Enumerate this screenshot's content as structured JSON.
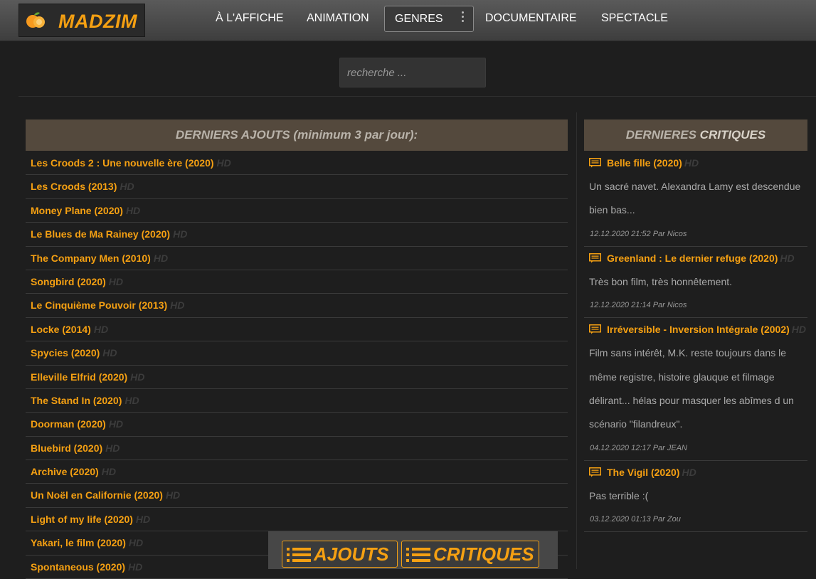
{
  "logo": {
    "text": "MADZIM"
  },
  "nav": {
    "items": [
      "À L'AFFICHE",
      "ANIMATION"
    ],
    "genres": "GENRES",
    "items_after": [
      "DOCUMENTAIRE",
      "SPECTACLE"
    ]
  },
  "search": {
    "placeholder": "recherche ..."
  },
  "latest": {
    "heading": "DERNIERS AJOUTS (minimum 3 par jour):",
    "quality": "HD",
    "films": [
      "Les Croods 2 : Une nouvelle ère (2020)",
      "Les Croods (2013)",
      "Money Plane (2020)",
      "Le Blues de Ma Rainey (2020)",
      "The Company Men (2010)",
      "Songbird (2020)",
      "Le Cinquième Pouvoir (2013)",
      "Locke (2014)",
      "Spycies (2020)",
      "Elleville Elfrid (2020)",
      "The Stand In (2020)",
      "Doorman (2020)",
      "Bluebird (2020)",
      "Archive (2020)",
      "Un Noël en Californie (2020)",
      "Light of my life (2020)",
      "Yakari, le film (2020)",
      "Spontaneous (2020)"
    ]
  },
  "reviews": {
    "heading_a": "DERNIERES ",
    "heading_b": "CRITIQUES",
    "quality": "HD",
    "items": [
      {
        "title": "Belle fille (2020)",
        "text": "Un sacré navet. Alexandra Lamy est descendue bien bas...",
        "meta": "12.12.2020 21:52 Par Nicos"
      },
      {
        "title": "Greenland : Le dernier refuge (2020)",
        "text": "Très bon film, très honnêtement.",
        "meta": "12.12.2020 21:14 Par Nicos"
      },
      {
        "title": "Irréversible - Inversion Intégrale (2002)",
        "text": "Film sans intérêt, M.K. reste toujours dans le même registre, histoire glauque et filmage délirant... hélas pour masquer les abîmes d un scénario \"filandreux\".",
        "meta": "04.12.2020 12:17 Par JEAN"
      },
      {
        "title": "The Vigil (2020)",
        "text": "Pas terrible :(",
        "meta": "03.12.2020 01:13 Par Zou"
      }
    ]
  },
  "bottom": {
    "ajouts": "AJOUTS",
    "critiques": "CRITIQUES"
  },
  "colors": {
    "accent": "#f5a012",
    "panel_head": "#54493d",
    "background": "#1e1e1e"
  }
}
